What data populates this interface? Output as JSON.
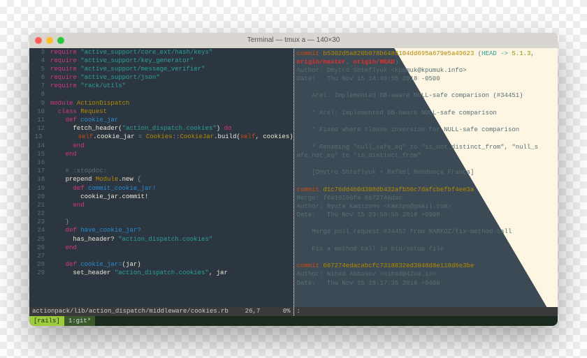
{
  "window": {
    "title": "Terminal — tmux a — 140×30"
  },
  "left": {
    "lines": [
      {
        "n": "3",
        "tokens": [
          [
            "c-kw",
            "require "
          ],
          [
            "c-str",
            "\"active_support/core_ext/hash/keys\""
          ]
        ]
      },
      {
        "n": "4",
        "tokens": [
          [
            "c-kw",
            "require "
          ],
          [
            "c-str",
            "\"active_support/key_generator\""
          ]
        ]
      },
      {
        "n": "5",
        "tokens": [
          [
            "c-kw",
            "require "
          ],
          [
            "c-str",
            "\"active_support/message_verifier\""
          ]
        ]
      },
      {
        "n": "6",
        "tokens": [
          [
            "c-kw",
            "require "
          ],
          [
            "c-str",
            "\"active_support/json\""
          ]
        ]
      },
      {
        "n": "7",
        "tokens": [
          [
            "c-kw",
            "require "
          ],
          [
            "c-str",
            "\"rack/utils\""
          ]
        ]
      },
      {
        "n": "8",
        "tokens": []
      },
      {
        "n": "9",
        "tokens": [
          [
            "c-kw",
            "module "
          ],
          [
            "c-const",
            "ActionDispatch"
          ]
        ]
      },
      {
        "n": "10",
        "tokens": [
          [
            "c-txt",
            "  "
          ],
          [
            "c-kw",
            "class "
          ],
          [
            "c-const",
            "Request"
          ]
        ]
      },
      {
        "n": "11",
        "tokens": [
          [
            "c-txt",
            "    "
          ],
          [
            "c-kw",
            "def "
          ],
          [
            "c-def",
            "cookie_jar"
          ]
        ]
      },
      {
        "n": "12",
        "tokens": [
          [
            "c-txt",
            "      "
          ],
          [
            "c-txt",
            "fetch_header("
          ],
          [
            "c-str",
            "\"action_dispatch.cookies\""
          ],
          [
            "c-txt",
            ") "
          ],
          [
            "c-kw",
            "do"
          ]
        ]
      },
      {
        "n": "13",
        "tokens": [
          [
            "c-txt",
            "        "
          ],
          [
            "c-self",
            "self"
          ],
          [
            "c-txt",
            ".cookie_jar "
          ],
          [
            "c-op",
            "="
          ],
          [
            "c-txt",
            " "
          ],
          [
            "c-const",
            "Cookies"
          ],
          [
            "c-op",
            "::"
          ],
          [
            "c-const",
            "CookieJar"
          ],
          [
            "c-txt",
            ".build("
          ],
          [
            "c-self",
            "self"
          ],
          [
            "c-txt",
            ", cookies)"
          ]
        ]
      },
      {
        "n": "14",
        "tokens": [
          [
            "c-txt",
            "      "
          ],
          [
            "c-kw",
            "end"
          ]
        ]
      },
      {
        "n": "15",
        "tokens": [
          [
            "c-txt",
            "    "
          ],
          [
            "c-kw",
            "end"
          ]
        ]
      },
      {
        "n": "16",
        "tokens": []
      },
      {
        "n": "17",
        "tokens": [
          [
            "c-txt",
            "    "
          ],
          [
            "c-comment",
            "# :stopdoc:"
          ]
        ]
      },
      {
        "n": "18",
        "tokens": [
          [
            "c-txt",
            "    "
          ],
          [
            "c-txt",
            "prepend "
          ],
          [
            "c-const",
            "Module"
          ],
          [
            "c-txt",
            ".new "
          ],
          [
            "c-op",
            "{"
          ]
        ]
      },
      {
        "n": "19",
        "tokens": [
          [
            "c-txt",
            "      "
          ],
          [
            "c-kw",
            "def "
          ],
          [
            "c-def",
            "commit_cookie_jar!"
          ]
        ]
      },
      {
        "n": "20",
        "tokens": [
          [
            "c-txt",
            "        cookie_jar.commit!"
          ]
        ]
      },
      {
        "n": "21",
        "tokens": [
          [
            "c-txt",
            "      "
          ],
          [
            "c-kw",
            "end"
          ]
        ]
      },
      {
        "n": "22",
        "tokens": []
      },
      {
        "n": "23",
        "tokens": [
          [
            "c-txt",
            "    "
          ],
          [
            "c-op",
            "}"
          ]
        ]
      },
      {
        "n": "24",
        "tokens": [
          [
            "c-txt",
            "    "
          ],
          [
            "c-kw",
            "def "
          ],
          [
            "c-def",
            "have_cookie_jar?"
          ]
        ]
      },
      {
        "n": "25",
        "tokens": [
          [
            "c-txt",
            "      has_header? "
          ],
          [
            "c-str",
            "\"action_dispatch.cookies\""
          ]
        ]
      },
      {
        "n": "26",
        "tokens": [
          [
            "c-txt",
            "    "
          ],
          [
            "c-kw",
            "end"
          ]
        ]
      },
      {
        "n": "27",
        "tokens": []
      },
      {
        "n": "28",
        "tokens": [
          [
            "c-txt",
            "    "
          ],
          [
            "c-kw",
            "def "
          ],
          [
            "c-def",
            "cookie_jar="
          ],
          [
            "c-txt",
            "(jar)"
          ]
        ]
      },
      {
        "n": "29",
        "tokens": [
          [
            "c-txt",
            "      set_header "
          ],
          [
            "c-str",
            "\"action_dispatch.cookies\""
          ],
          [
            "c-txt",
            ", jar"
          ]
        ]
      }
    ],
    "status": {
      "path": "actionpack/lib/action_dispatch/middleware/cookies.rb",
      "pos": "26,7",
      "pct": "0%"
    }
  },
  "right": {
    "lines": [
      [
        [
          "g-commit",
          "commit "
        ],
        [
          "g-hash",
          "b5302d5a820b078b6488104dd695a679e5a49623"
        ],
        [
          "g-sub",
          " ("
        ],
        [
          "g-ref-head",
          "HEAD -> "
        ],
        [
          "g-ref-branch",
          "5.1.3"
        ],
        [
          "g-sub",
          ","
        ]
      ],
      [
        [
          "g-ref-red",
          "origin/master"
        ],
        [
          "g-sub",
          ", "
        ],
        [
          "g-ref-red",
          "origin/HEAD"
        ],
        [
          "g-sub",
          ")"
        ]
      ],
      [
        [
          "g-sub",
          "Author: Dmytro Shteflyuk <kpumuk@kpumuk.info>"
        ]
      ],
      [
        [
          "g-sub",
          "Date:   Thu Nov 15 14:49:55 2018 -0500"
        ]
      ],
      [],
      [
        [
          "g-sub",
          "    Arel: Implemented DB-aware NULL-safe comparison (#34451)"
        ]
      ],
      [],
      [
        [
          "g-sub",
          "    * Arel: Implemented DB-aware NULL-safe comparison"
        ]
      ],
      [],
      [
        [
          "g-sub",
          "    * Fixed where clause inversion for NULL-safe comparison"
        ]
      ],
      [],
      [
        [
          "g-sub",
          "    * Renaming \"null_safe_eq\" to \"is_not_distinct_from\", \"null_s"
        ]
      ],
      [
        [
          "g-sub",
          "afe_not_eq\" to \"is_distinct_from\""
        ]
      ],
      [],
      [
        [
          "g-sub",
          "    [Dmytro Shteflyuk + Rafael Mendonça França]"
        ]
      ],
      [],
      [
        [
          "g-commit",
          "commit "
        ],
        [
          "g-hash",
          "d1c76dd4b0d308db432afb56c7dafcbefbf4ee3a"
        ]
      ],
      [
        [
          "g-sub",
          "Merge: f6a16106fa 667274edac"
        ]
      ],
      [
        [
          "g-sub",
          "Author: Ryuta Kamizono <kamipo@gmail.com>"
        ]
      ],
      [
        [
          "g-sub",
          "Date:   Thu Nov 15 23:58:56 2018 +0900"
        ]
      ],
      [],
      [
        [
          "g-sub",
          "    Merge pull request #34457 from NARKOZ/fix-method-call"
        ]
      ],
      [],
      [
        [
          "g-sub",
          "    Fix a method call in bin/setup file"
        ]
      ],
      [],
      [
        [
          "g-commit",
          "commit "
        ],
        [
          "g-hash",
          "667274edacabcfc7318832ed3048d8e118d6e3be"
        ]
      ],
      [
        [
          "g-sub",
          "Author: Nihad Abbasov <nihad@42na.in>"
        ]
      ],
      [
        [
          "g-sub",
          "Date:   Thu Nov 15 18:17:35 2018 +0400"
        ]
      ]
    ],
    "status": ":"
  },
  "tmux": {
    "session": "[rails]",
    "window": "1:git*"
  }
}
